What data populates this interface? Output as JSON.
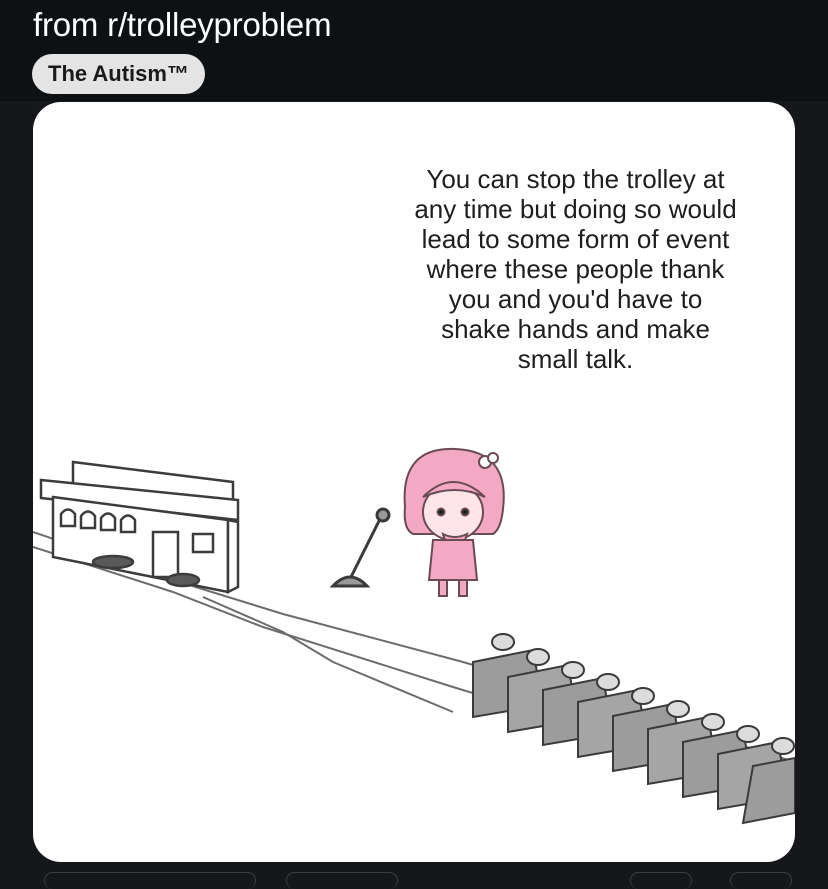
{
  "post": {
    "subreddit_title": "from r/trolleyproblem",
    "flair": "The Autism™"
  },
  "meme": {
    "caption": "You can stop the trolley at\nany time but doing so would\nlead to some form of event\nwhere these people thank\nyou and you'd have to\nshake hands and make\nsmall talk."
  },
  "colors": {
    "background": "#16171b",
    "header": "#0e1114",
    "flair_bg": "#e4e4e4",
    "character_pink": "#f3a8c3"
  }
}
